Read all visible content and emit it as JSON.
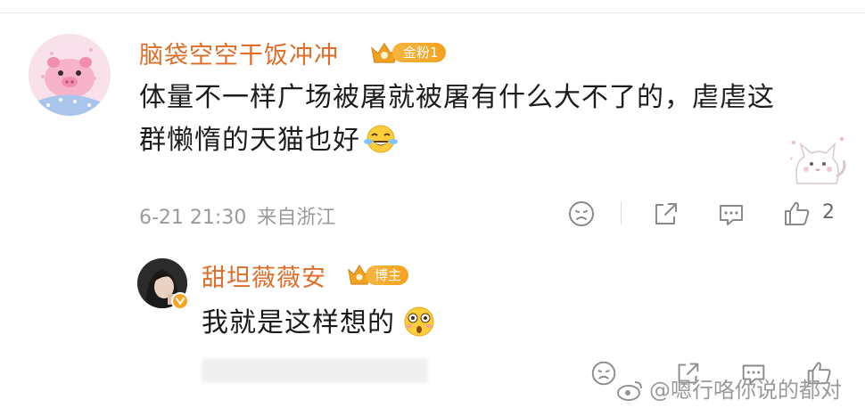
{
  "main_comment": {
    "username": "脑袋空空干饭冲冲",
    "badge": "金粉1",
    "text_lines": [
      "体量不一样广场被屠就被屠有什么大不了的，虐虐这",
      "群懒惰的天猫也好"
    ],
    "date": "6-21 21:30",
    "location": "来自浙江",
    "like_count": "2",
    "icons": [
      "dislike-icon",
      "share-icon",
      "comment-icon",
      "like-icon"
    ]
  },
  "reply": {
    "username": "甜坦薇薇安",
    "badge": "博主",
    "text": "我就是这样想的"
  },
  "watermark": {
    "text": "@嗯行咯你说的都对"
  },
  "colors": {
    "username": "#e06c27",
    "badge": "#f3a21f",
    "meta": "#9a9a9a",
    "icon": "#8a8a8a"
  }
}
